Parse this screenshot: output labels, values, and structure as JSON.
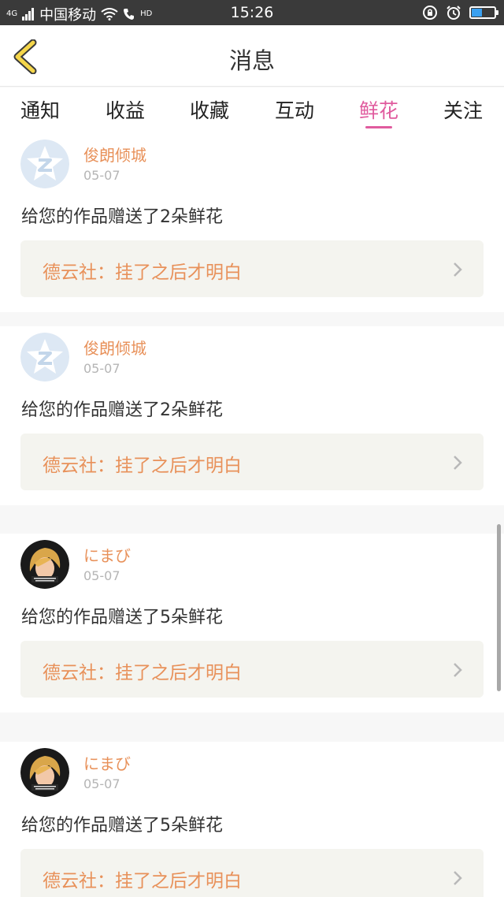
{
  "status_bar": {
    "network": "4G",
    "carrier": "中国移动",
    "hd": "HD",
    "time": "15:26",
    "battery_level": 0.45
  },
  "header": {
    "title": "消息"
  },
  "tabs": [
    {
      "label": "通知",
      "active": false
    },
    {
      "label": "收益",
      "active": false
    },
    {
      "label": "收藏",
      "active": false
    },
    {
      "label": "互动",
      "active": false
    },
    {
      "label": "鲜花",
      "active": true
    },
    {
      "label": "关注",
      "active": false
    }
  ],
  "colors": {
    "accent": "#e05b9e",
    "name_orange": "#e8915a"
  },
  "messages": [
    {
      "user": "俊朗倾城",
      "date": "05-07",
      "text": "给您的作品赠送了2朵鲜花",
      "work": "德云社：挂了之后才明白",
      "avatar": "default-qzone-avatar"
    },
    {
      "user": "俊朗倾城",
      "date": "05-07",
      "text": "给您的作品赠送了2朵鲜花",
      "work": "德云社：挂了之后才明白",
      "avatar": "default-qzone-avatar"
    },
    {
      "user": "にまび",
      "date": "05-07",
      "text": "给您的作品赠送了5朵鲜花",
      "work": "德云社：挂了之后才明白",
      "avatar": "cartoon-girl-avatar"
    },
    {
      "user": "にまび",
      "date": "05-07",
      "text": "给您的作品赠送了5朵鲜花",
      "work": "德云社：挂了之后才明白",
      "avatar": "cartoon-girl-avatar"
    }
  ]
}
